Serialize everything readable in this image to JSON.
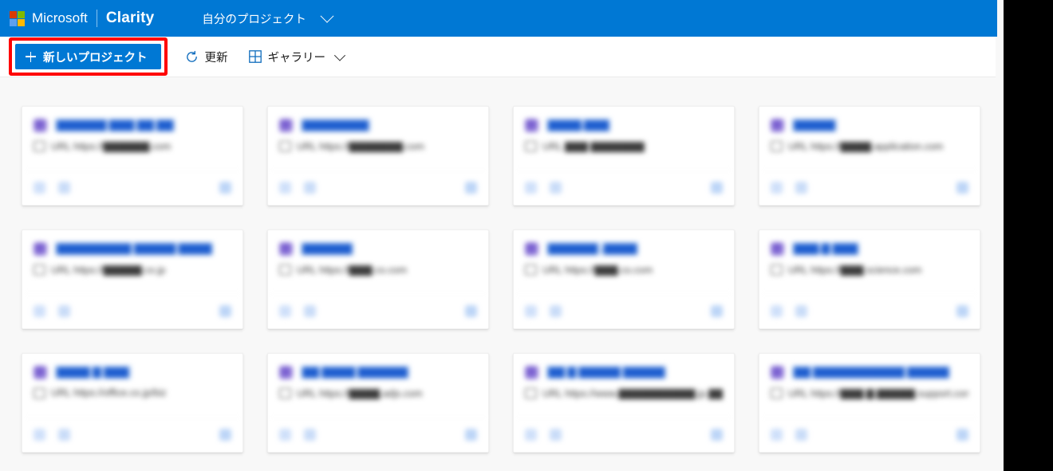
{
  "header": {
    "logo_icon": "microsoft-logo-icon",
    "microsoft_word": "Microsoft",
    "brand": "Clarity",
    "project_switcher_label": "自分のプロジェクト",
    "chevron_icon": "chevron-down-icon",
    "background_color": "#0078d4"
  },
  "toolbar": {
    "new_project_label": "新しいプロジェクト",
    "new_project_plus_icon": "plus-icon",
    "new_project_highlight_color": "#ff0000",
    "new_project_button_color": "#0078d4",
    "refresh_label": "更新",
    "refresh_icon": "refresh-spinner-icon",
    "gallery_label": "ギャラリー",
    "gallery_icon": "grid-view-icon",
    "gallery_chevron_icon": "chevron-down-icon"
  },
  "content": {
    "background_color": "#f8f8f8",
    "note": "project card contents are privacy-blurred in the screenshot",
    "cards": [
      {
        "site_icon": "project-favicon-icon",
        "title": "▇▇▇▇▇▇ ▇▇▇ ▇▇ ▇▇",
        "url_icon": "globe-icon",
        "url": "URL https://▇▇▇▇▇▇.com",
        "footer_icons": [
          "stat-icon",
          "stat-icon",
          "settings-icon"
        ]
      },
      {
        "site_icon": "project-favicon-icon",
        "title": "▇▇▇▇▇▇▇▇",
        "url_icon": "globe-icon",
        "url": "URL https://▇▇▇▇▇▇▇.com",
        "footer_icons": [
          "stat-icon",
          "stat-icon",
          "settings-icon"
        ]
      },
      {
        "site_icon": "project-favicon-icon",
        "title": "▇▇▇▇.▇▇▇",
        "url_icon": "globe-icon",
        "url": "URL ▇▇▇ ▇▇▇▇▇▇▇",
        "footer_icons": [
          "stat-icon",
          "stat-icon",
          "settings-icon"
        ]
      },
      {
        "site_icon": "project-favicon-icon",
        "title": "▇▇▇▇▇",
        "url_icon": "globe-icon",
        "url": "URL https://▇▇▇▇.application.com",
        "footer_icons": [
          "stat-icon",
          "stat-icon",
          "settings-icon"
        ]
      },
      {
        "site_icon": "project-favicon-icon",
        "title": "▇▇▇▇▇▇▇▇▇ ▇▇▇▇▇ ▇▇▇▇",
        "url_icon": "globe-icon",
        "url": "URL https://▇▇▇▇▇.co.jp",
        "footer_icons": [
          "stat-icon",
          "stat-icon",
          "settings-icon"
        ]
      },
      {
        "site_icon": "project-favicon-icon",
        "title": "▇▇▇▇▇▇",
        "url_icon": "globe-icon",
        "url": "URL https://▇▇▇.co.com",
        "footer_icons": [
          "stat-icon",
          "stat-icon",
          "settings-icon"
        ]
      },
      {
        "site_icon": "project-favicon-icon",
        "title": "▇▇▇▇▇▇ .▇▇▇▇",
        "url_icon": "globe-icon",
        "url": "URL https://▇▇▇.co.com",
        "footer_icons": [
          "stat-icon",
          "stat-icon",
          "settings-icon"
        ]
      },
      {
        "site_icon": "project-favicon-icon",
        "title": "▇▇▇.▇ ▇▇▇",
        "url_icon": "globe-icon",
        "url": "URL https://▇▇▇.science.com",
        "footer_icons": [
          "stat-icon",
          "stat-icon",
          "settings-icon"
        ]
      },
      {
        "site_icon": "project-favicon-icon",
        "title": "▇▇▇▇ ▇ ▇▇▇",
        "url_icon": "globe-icon",
        "url": "URL https://office.co.jp/biz",
        "footer_icons": [
          "stat-icon",
          "stat-icon",
          "settings-icon"
        ]
      },
      {
        "site_icon": "project-favicon-icon",
        "title": "▇▇ ▇▇▇▇ ▇▇▇▇▇▇",
        "url_icon": "globe-icon",
        "url": "URL https://▇▇▇▇.adjs.com",
        "footer_icons": [
          "stat-icon",
          "stat-icon",
          "settings-icon"
        ]
      },
      {
        "site_icon": "project-favicon-icon",
        "title": "▇▇ ▇ ▇▇▇▇▇ ▇▇▇▇▇",
        "url_icon": "globe-icon",
        "url": "URL https://www.▇▇▇▇▇▇▇▇▇▇.jp.▇▇▇▇▇",
        "footer_icons": [
          "stat-icon",
          "stat-icon",
          "settings-icon"
        ]
      },
      {
        "site_icon": "project-favicon-icon",
        "title": "▇▇ ▇▇▇▇▇▇▇▇▇▇▇ ▇▇▇▇▇",
        "url_icon": "globe-icon",
        "url": "URL https://▇▇▇.▇.▇▇▇▇▇.support.com",
        "footer_icons": [
          "stat-icon",
          "stat-icon",
          "settings-icon"
        ]
      }
    ]
  }
}
